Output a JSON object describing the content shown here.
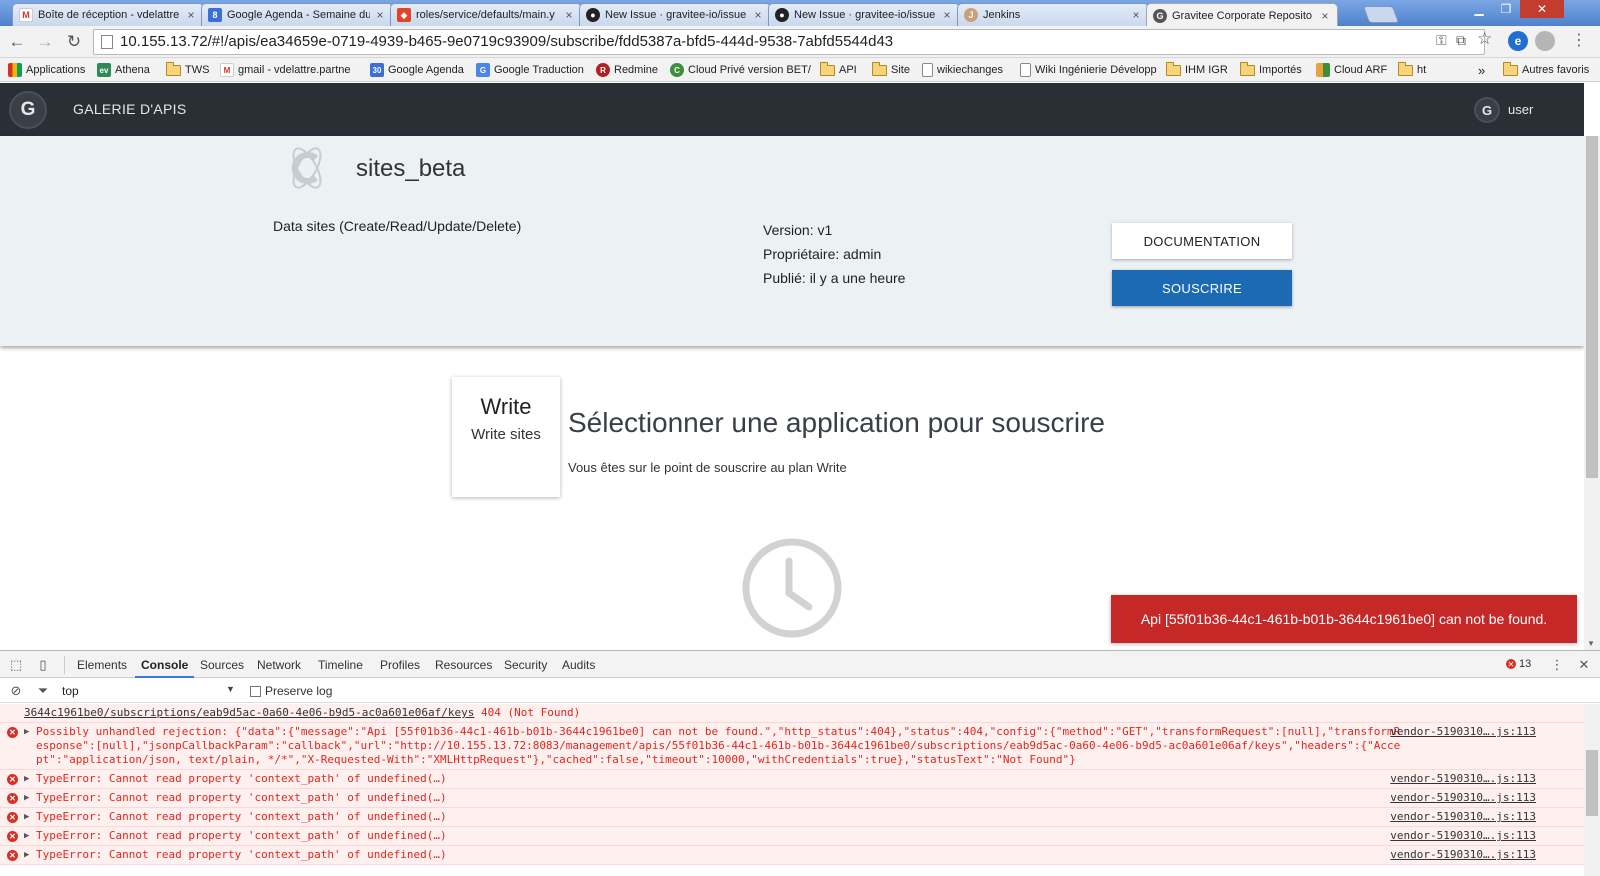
{
  "browser": {
    "tabs": [
      {
        "label": "Boîte de réception - vdelattre",
        "icon": "gmail-icon",
        "color": "#d93025",
        "glyph": "M"
      },
      {
        "label": "Google Agenda - Semaine du",
        "icon": "google-calendar-icon",
        "color": "#3a6fd8",
        "glyph": "8"
      },
      {
        "label": "roles/service/defaults/main.y",
        "icon": "gitlab-icon",
        "color": "#e24329",
        "glyph": "◆"
      },
      {
        "label": "New Issue · gravitee-io/issue",
        "icon": "github-icon",
        "color": "#222222",
        "glyph": "●"
      },
      {
        "label": "New Issue · gravitee-io/issue",
        "icon": "github-icon",
        "color": "#222222",
        "glyph": "●"
      },
      {
        "label": "Jenkins",
        "icon": "jenkins-icon",
        "color": "#c9a07a",
        "glyph": "J"
      },
      {
        "label": "Gravitee Corporate Reposito",
        "icon": "gravitee-icon",
        "color": "#555555",
        "glyph": "G"
      }
    ],
    "close_glyph": "×",
    "url": "10.155.13.72/#!/apis/ea34659e-0719-4939-b465-9e0719c93909/subscribe/fdd5387a-bfd5-444d-9538-7abfd5544d43",
    "bookmarks": [
      {
        "label": "Applications",
        "type": "apps"
      },
      {
        "label": "Athena",
        "type": "site",
        "color": "#2e8b57",
        "glyph": "ev"
      },
      {
        "label": "TWS",
        "type": "folder"
      },
      {
        "label": "gmail - vdelattre.partne",
        "type": "site",
        "color": "#d93025",
        "glyph": "M"
      },
      {
        "label": "Google Agenda",
        "type": "site",
        "color": "#3a6fd8",
        "glyph": "30"
      },
      {
        "label": "Google Traduction",
        "type": "site",
        "color": "#4a86e8",
        "glyph": "G"
      },
      {
        "label": "Redmine",
        "type": "site",
        "color": "#b32024",
        "glyph": "R"
      },
      {
        "label": "Cloud Privé version BET/",
        "type": "site",
        "color": "#3d8f3d",
        "glyph": "C"
      },
      {
        "label": "API",
        "type": "folder"
      },
      {
        "label": "Site",
        "type": "folder"
      },
      {
        "label": "wikiechanges",
        "type": "page"
      },
      {
        "label": "Wiki Ingénierie Développ",
        "type": "page"
      },
      {
        "label": "IHM IGR",
        "type": "folder"
      },
      {
        "label": "Importés",
        "type": "folder"
      },
      {
        "label": "Cloud ARF",
        "type": "site",
        "color": "#e8a33d",
        "glyph": "▦"
      },
      {
        "label": "ht",
        "type": "folder"
      }
    ],
    "more_bookmarks": "»",
    "other_bookmarks": "Autres favoris"
  },
  "app": {
    "brand": "GALERIE D'APIS",
    "user": "user",
    "api": {
      "name": "sites_beta",
      "description": "Data sites (Create/Read/Update/Delete)",
      "version": "Version: v1",
      "owner": "Propriétaire: admin",
      "published": "Publié: il y a une heure",
      "doc_button": "DOCUMENTATION",
      "subscribe_button": "SOUSCRIRE"
    },
    "plan": {
      "name": "Write",
      "description": "Write sites"
    },
    "select_title": "Sélectionner une application pour souscrire",
    "select_subtitle": "Vous êtes sur le point de souscrire au plan Write",
    "toast": "Api [55f01b36-44c1-461b-b01b-3644c1961be0] can not be found."
  },
  "devtools": {
    "tabs": [
      "Elements",
      "Console",
      "Sources",
      "Network",
      "Timeline",
      "Profiles",
      "Resources",
      "Security",
      "Audits"
    ],
    "active_tab": "Console",
    "error_count": "13",
    "context": "top",
    "preserve_log": "Preserve log",
    "first_line_url": "3644c1961be0/subscriptions/eab9d5ac-0a60-4e06-b9d5-ac0a601e06af/keys",
    "first_line_status": "404 (Not Found)",
    "rejection_message": "Possibly unhandled rejection: {\"data\":{\"message\":\"Api [55f01b36-44c1-461b-b01b-3644c1961be0] can not be found.\",\"http_status\":404},\"status\":404,\"config\":{\"method\":\"GET\",\"transformRequest\":[null],\"transformResponse\":[null],\"jsonpCallbackParam\":\"callback\",\"url\":\"http://10.155.13.72:8083/management/apis/55f01b36-44c1-461b-b01b-3644c1961be0/subscriptions/eab9d5ac-0a60-4e06-b9d5-ac0a601e06af/keys\",\"headers\":{\"Accept\":\"application/json, text/plain, */*\",\"X-Requested-With\":\"XMLHttpRequest\"},\"cached\":false,\"timeout\":10000,\"withCredentials\":true},\"statusText\":\"Not Found\"}",
    "type_error": "TypeError: Cannot read property 'context_path' of undefined(…)",
    "source": "vendor-5190310….js:113"
  }
}
